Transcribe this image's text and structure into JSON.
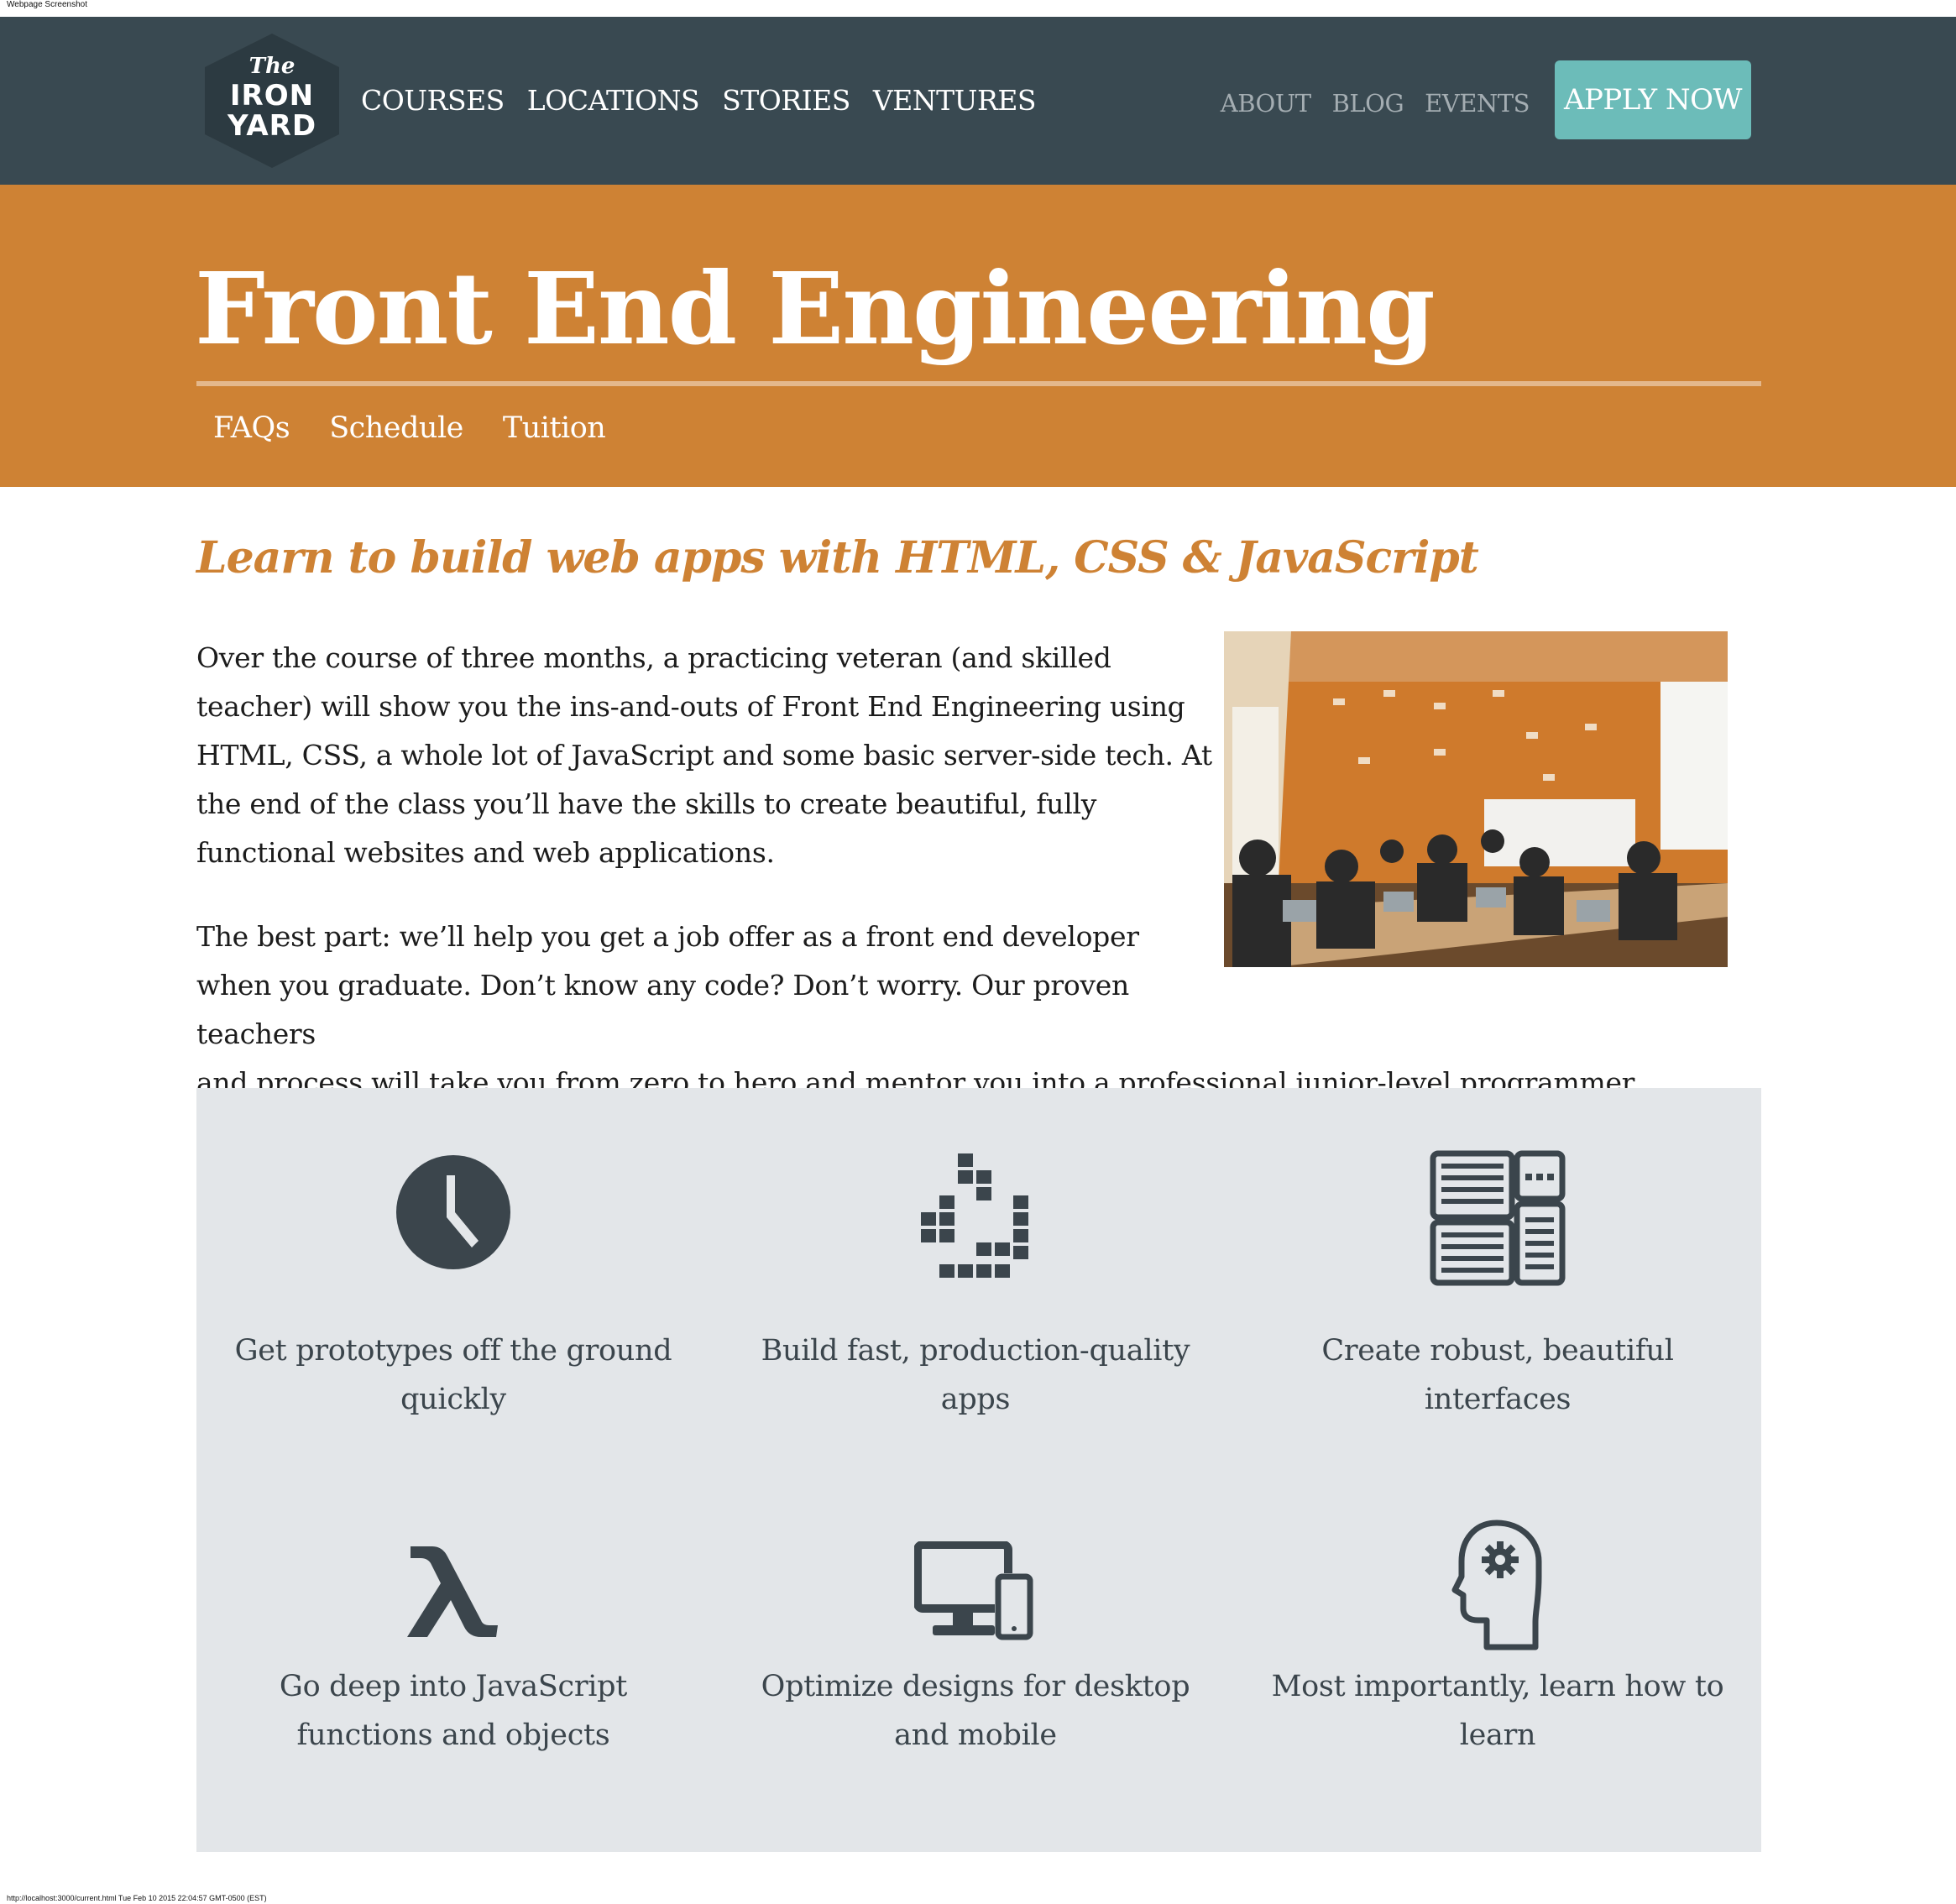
{
  "screenshot": {
    "caption": "Webpage Screenshot",
    "footer_url": "http://localhost:3000/current.html Tue Feb 10 2015 22:04:57 GMT-0500 (EST)"
  },
  "header": {
    "logo": {
      "line1": "The",
      "line2": "IRON",
      "line3": "YARD"
    },
    "main_nav": [
      "COURSES",
      "LOCATIONS",
      "STORIES",
      "VENTURES"
    ],
    "secondary_nav": [
      "ABOUT",
      "BLOG",
      "EVENTS"
    ],
    "apply_label": "APPLY NOW"
  },
  "hero": {
    "title": "Front End Engineering",
    "tabs": [
      "FAQs",
      "Schedule",
      "Tuition"
    ]
  },
  "content": {
    "subtitle": "Learn to build web apps with HTML, CSS & JavaScript",
    "paragraph1": "Over the course of three months, a practicing veteran (and skilled teacher) will show you the ins-and-outs of Front End Engineering using HTML, CSS, a whole lot of JavaScript and some basic server-side tech. At the end of the class you’ll have the skills to create beautiful, fully functional websites and web applications.",
    "paragraph2_wrapped": "The best part: we’ll help you get a job offer as a front end developer when you graduate. Don’t know any code? Don’t worry. Our proven teachers",
    "paragraph2_tail": "and process will take you from zero to hero and mentor you into a professional junior-level programmer."
  },
  "features": [
    {
      "icon": "clock-icon",
      "text": "Get prototypes off the ground quickly"
    },
    {
      "icon": "pixel-loader-icon",
      "text": "Build fast, production-quality apps"
    },
    {
      "icon": "interface-layout-icon",
      "text": "Create robust, beautiful interfaces"
    },
    {
      "icon": "lambda-icon",
      "text": "Go deep into JavaScript functions and objects"
    },
    {
      "icon": "desktop-mobile-icon",
      "text": "Optimize designs for desktop and mobile"
    },
    {
      "icon": "head-gear-icon",
      "text": "Most importantly, learn how to learn"
    }
  ],
  "colors": {
    "header_bg": "#394951",
    "hero_bg": "#ce8234",
    "accent_orange": "#ce8234",
    "apply_button": "#6cbcb9",
    "features_bg": "#e3e6e9",
    "icon_color": "#3b454c"
  }
}
